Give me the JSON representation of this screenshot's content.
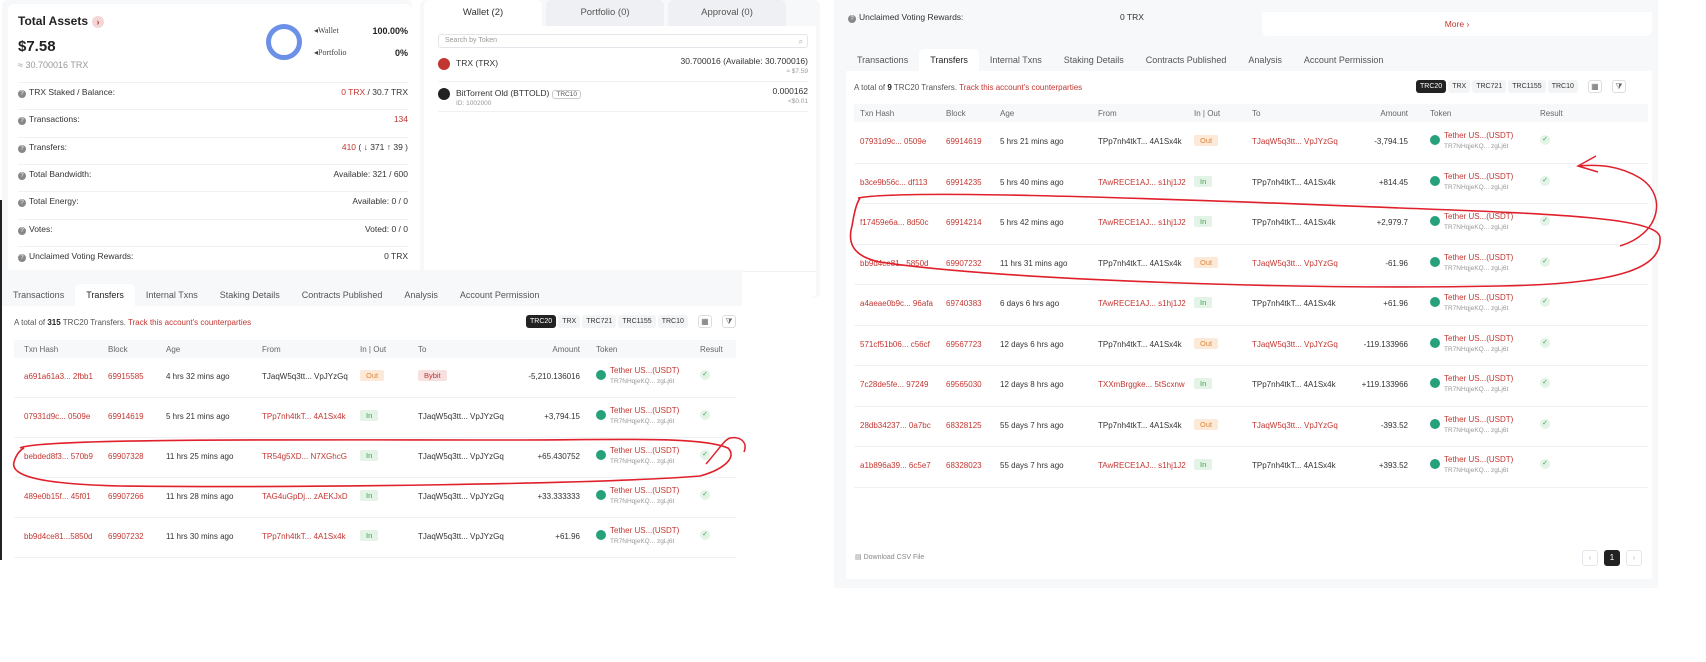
{
  "assets": {
    "title": "Total Assets",
    "value": "$7.58",
    "sub": "≈ 30.700016 TRX",
    "legend": [
      {
        "label": "Wallet",
        "pct": "100.00%"
      },
      {
        "label": "Portfolio",
        "pct": "0%"
      }
    ],
    "rows": [
      {
        "label": "TRX Staked / Balance:",
        "value_red": "0 TRX",
        "value": " / 30.7 TRX"
      },
      {
        "label": "Transactions:",
        "value_red": "134",
        "value": ""
      },
      {
        "label": "Transfers:",
        "value_red": "410",
        "value": " ( ↓ 371  ↑ 39 )"
      },
      {
        "label": "Total Bandwidth:",
        "value_red": "",
        "value": "Available: 321 / 600"
      },
      {
        "label": "Total Energy:",
        "value_red": "",
        "value": "Available: 0 / 0"
      },
      {
        "label": "Votes:",
        "value_red": "",
        "value": "Voted: 0 / 0"
      },
      {
        "label": "Unclaimed Voting Rewards:",
        "value_red": "",
        "value": "0 TRX"
      }
    ]
  },
  "wallet": {
    "tabs": [
      "Wallet (2)",
      "Portfolio (0)",
      "Approval (0)"
    ],
    "search_placeholder": "Search by Token",
    "tokens": [
      {
        "name": "TRX (TRX)",
        "id": "",
        "chip": "",
        "balance": "30.700016 (Available: 30.700016)",
        "usd": "≈ $7.59"
      },
      {
        "name": "BitTorrent Old (BTTOLD)",
        "id": "ID: 1002000",
        "chip": "TRC10",
        "balance": "0.000162",
        "usd": "<$0.01"
      }
    ],
    "more": "More ›"
  },
  "left_table": {
    "tabs": [
      "Transactions",
      "Transfers",
      "Internal Txns",
      "Staking Details",
      "Contracts Published",
      "Analysis",
      "Account Permission"
    ],
    "summary_pre": "A total of ",
    "summary_count": "315",
    "summary_post": " TRC20 Transfers.",
    "summary_link": "Track this account's counterparties",
    "filters": [
      "TRC20",
      "TRX",
      "TRC721",
      "TRC1155",
      "TRC10"
    ],
    "headers": [
      "Txn Hash",
      "Block",
      "Age",
      "From",
      "In | Out",
      "To",
      "Amount",
      "Token",
      "Result"
    ],
    "rows": [
      {
        "hash": "a691a61a3... 2fbb1",
        "block": "69915585",
        "age": "4 hrs 32 mins ago",
        "from": "TJaqW5q3tt... VpJYzGq",
        "dir": "Out",
        "to": "Bybit",
        "amount": "-5,210.136016",
        "token": "Tether US...(USDT)",
        "token_addr": "TR7NHqjeKQ... zgLj6t"
      },
      {
        "hash": "07931d9c... 0509e",
        "block": "69914619",
        "age": "5 hrs 21 mins ago",
        "from": "TPp7nh4tkT... 4A1Sx4k",
        "dir": "In",
        "to": "TJaqW5q3tt... VpJYzGq",
        "amount": "+3,794.15",
        "token": "Tether US...(USDT)",
        "token_addr": "TR7NHqjeKQ... zgLj6t"
      },
      {
        "hash": "bebded8f3... 570b9",
        "block": "69907328",
        "age": "11 hrs 25 mins ago",
        "from": "TR54g5XD... N7XGhcG",
        "dir": "In",
        "to": "TJaqW5q3tt... VpJYzGq",
        "amount": "+65.430752",
        "token": "Tether US...(USDT)",
        "token_addr": "TR7NHqjeKQ... zgLj6t"
      },
      {
        "hash": "489e0b15f... 45f01",
        "block": "69907266",
        "age": "11 hrs 28 mins ago",
        "from": "TAG4uGpDj... zAEKJxD",
        "dir": "In",
        "to": "TJaqW5q3tt... VpJYzGq",
        "amount": "+33.333333",
        "token": "Tether US...(USDT)",
        "token_addr": "TR7NHqjeKQ... zgLj6t"
      },
      {
        "hash": "bb9d4ce81...5850d",
        "block": "69907232",
        "age": "11 hrs 30 mins ago",
        "from": "TPp7nh4tkT... 4A1Sx4k",
        "dir": "In",
        "to": "TJaqW5q3tt... VpJYzGq",
        "amount": "+61.96",
        "token": "Tether US...(USDT)",
        "token_addr": "TR7NHqjeKQ... zgLj6t"
      }
    ]
  },
  "right_table": {
    "unclaimed_label": "Unclaimed Voting Rewards:",
    "unclaimed_value": "0 TRX",
    "more": "More ›",
    "tabs": [
      "Transactions",
      "Transfers",
      "Internal Txns",
      "Staking Details",
      "Contracts Published",
      "Analysis",
      "Account Permission"
    ],
    "summary_pre": "A total of ",
    "summary_count": "9",
    "summary_post": " TRC20 Transfers.",
    "summary_link": "Track this account's counterparties",
    "filters": [
      "TRC20",
      "TRX",
      "TRC721",
      "TRC1155",
      "TRC10"
    ],
    "headers": [
      "Txn Hash",
      "Block",
      "Age",
      "From",
      "In | Out",
      "To",
      "Amount",
      "Token",
      "Result"
    ],
    "rows": [
      {
        "hash": "07931d9c... 0509e",
        "block": "69914619",
        "age": "5 hrs 21 mins ago",
        "from": "TPp7nh4tkT... 4A1Sx4k",
        "dir": "Out",
        "to": "TJaqW5q3tt... VpJYzGq",
        "amount": "-3,794.15",
        "token": "Tether US...(USDT)",
        "token_addr": "TR7NHqjeKQ... zgLj6t"
      },
      {
        "hash": "b3ce9b56c... df113",
        "block": "69914235",
        "age": "5 hrs 40 mins ago",
        "from": "TAwRECE1AJ... s1hj1J2",
        "dir": "In",
        "to": "TPp7nh4tkT... 4A1Sx4k",
        "amount": "+814.45",
        "token": "Tether US...(USDT)",
        "token_addr": "TR7NHqjeKQ... zgLj6t"
      },
      {
        "hash": "f17459e6a... 8d50c",
        "block": "69914214",
        "age": "5 hrs 42 mins ago",
        "from": "TAwRECE1AJ... s1hj1J2",
        "dir": "In",
        "to": "TPp7nh4tkT... 4A1Sx4k",
        "amount": "+2,979.7",
        "token": "Tether US...(USDT)",
        "token_addr": "TR7NHqjeKQ... zgLj6t"
      },
      {
        "hash": "bb9d4ce81...5850d",
        "block": "69907232",
        "age": "11 hrs 31 mins ago",
        "from": "TPp7nh4tkT... 4A1Sx4k",
        "dir": "Out",
        "to": "TJaqW5q3tt... VpJYzGq",
        "amount": "-61.96",
        "token": "Tether US...(USDT)",
        "token_addr": "TR7NHqjeKQ... zgLj6t"
      },
      {
        "hash": "a4aeae0b9c... 96afa",
        "block": "69740383",
        "age": "6 days 6 hrs ago",
        "from": "TAwRECE1AJ... s1hj1J2",
        "dir": "In",
        "to": "TPp7nh4tkT... 4A1Sx4k",
        "amount": "+61.96",
        "token": "Tether US...(USDT)",
        "token_addr": "TR7NHqjeKQ... zgLj6t"
      },
      {
        "hash": "571cf51b06... c56cf",
        "block": "69567723",
        "age": "12 days 6 hrs ago",
        "from": "TPp7nh4tkT... 4A1Sx4k",
        "dir": "Out",
        "to": "TJaqW5q3tt... VpJYzGq",
        "amount": "-119.133966",
        "token": "Tether US...(USDT)",
        "token_addr": "TR7NHqjeKQ... zgLj6t"
      },
      {
        "hash": "7c28de5fe... 97249",
        "block": "69565030",
        "age": "12 days 8 hrs ago",
        "from": "TXXmBrggke... 5tScxnw",
        "dir": "In",
        "to": "TPp7nh4tkT... 4A1Sx4k",
        "amount": "+119.133966",
        "token": "Tether US...(USDT)",
        "token_addr": "TR7NHqjeKQ... zgLj6t"
      },
      {
        "hash": "28db34237... 0a7bc",
        "block": "68328125",
        "age": "55 days 7 hrs ago",
        "from": "TPp7nh4tkT... 4A1Sx4k",
        "dir": "Out",
        "to": "TJaqW5q3tt... VpJYzGq",
        "amount": "-393.52",
        "token": "Tether US...(USDT)",
        "token_addr": "TR7NHqjeKQ... zgLj6t"
      },
      {
        "hash": "a1b896a39... 6c5e7",
        "block": "68328023",
        "age": "55 days 7 hrs ago",
        "from": "TAwRECE1AJ... s1hj1J2",
        "dir": "In",
        "to": "TPp7nh4tkT... 4A1Sx4k",
        "amount": "+393.52",
        "token": "Tether US...(USDT)",
        "token_addr": "TR7NHqjeKQ... zgLj6t"
      }
    ],
    "csv": "Download CSV File",
    "page": "1"
  },
  "colors": {
    "accent": "#c23631",
    "in": "#3aa052",
    "out": "#e0883a",
    "tether": "#26a17b",
    "donut": "#6c8fe8"
  },
  "icons": [
    "question-icon",
    "chevron-right-icon",
    "search-icon",
    "calendar-icon",
    "filter-icon",
    "check-icon",
    "tether-icon",
    "trx-icon",
    "bittorrent-icon",
    "csv-icon"
  ]
}
